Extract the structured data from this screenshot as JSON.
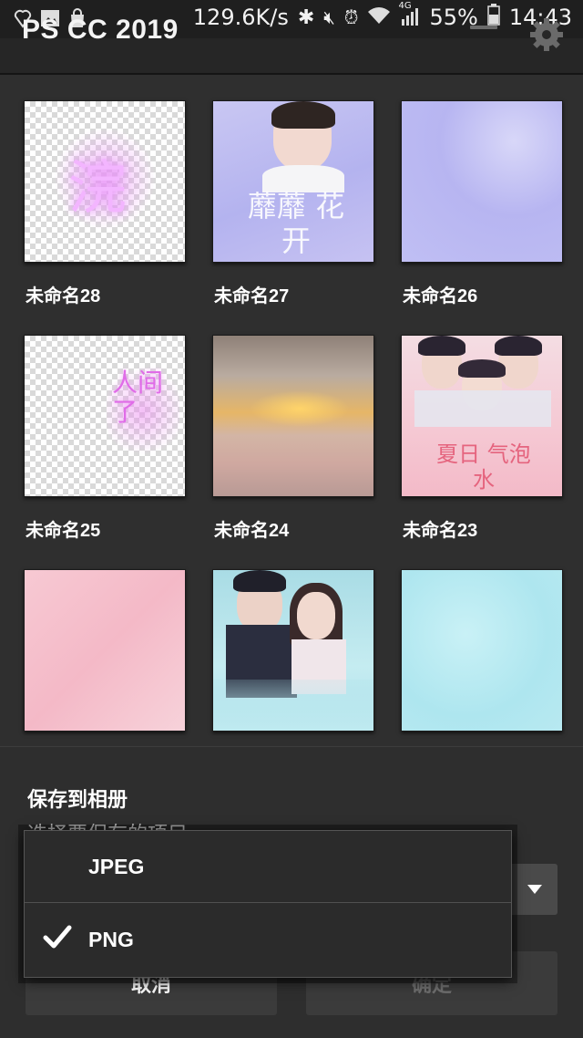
{
  "status_bar": {
    "net_speed": "129.6K/s",
    "network": "4G",
    "battery": "55%",
    "time": "14:43"
  },
  "app": {
    "title": "PS CC 2019"
  },
  "documents": [
    {
      "name": "未命名28",
      "thumb_text": "浣"
    },
    {
      "name": "未命名27",
      "thumb_text": "蘼蘼 花开"
    },
    {
      "name": "未命名26"
    },
    {
      "name": "未命名25",
      "thumb_text": "人间了"
    },
    {
      "name": "未命名24"
    },
    {
      "name": "未命名23",
      "thumb_text": "夏日 气泡水"
    },
    {
      "name": ""
    },
    {
      "name": ""
    },
    {
      "name": ""
    }
  ],
  "dialog": {
    "title": "保存到相册",
    "subtitle": "选择要保存的项目",
    "cancel_label": "取消",
    "confirm_label": "确定"
  },
  "format_dropdown": {
    "options": [
      {
        "label": "JPEG",
        "selected": false
      },
      {
        "label": "PNG",
        "selected": true
      }
    ]
  },
  "colors": {
    "background": "#2f2f2f",
    "dialog": "#2e2e2e",
    "button": "#3b3b3b",
    "text": "#ffffff",
    "disabled_text": "#6f6f6f"
  }
}
